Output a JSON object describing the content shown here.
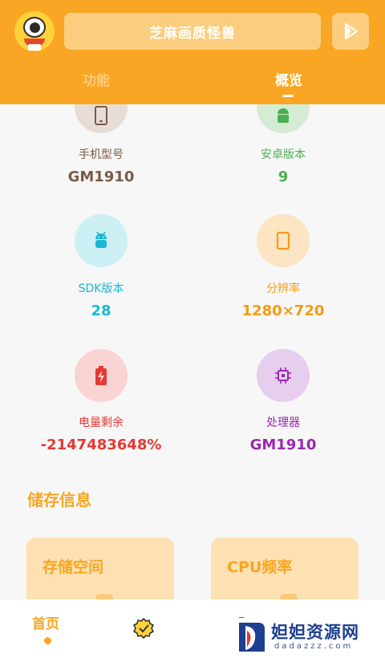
{
  "header": {
    "title": "芝麻画质怪兽",
    "tabs": [
      {
        "label": "功能",
        "active": false
      },
      {
        "label": "概览",
        "active": true
      }
    ],
    "accent_color": "#f8a623",
    "icons": {
      "avatar": "monster-avatar",
      "play": "play-icon"
    }
  },
  "device_info": [
    {
      "label": "手机型号",
      "value": "GM1910",
      "icon": "phone-icon",
      "color": "#7a5a49",
      "circle": "#e6ddd8"
    },
    {
      "label": "安卓版本",
      "value": "9",
      "icon": "android-icon",
      "color": "#4caf50",
      "circle": "#d3ecd3"
    },
    {
      "label": "SDK版本",
      "value": "28",
      "icon": "android-icon",
      "color": "#1ab8d2",
      "circle": "#cdf0f5"
    },
    {
      "label": "分辨率",
      "value": "1280×720",
      "icon": "screen-icon",
      "color": "#f39c12",
      "circle": "#fde4c2"
    },
    {
      "label": "电量剩余",
      "value": "-2147483648%",
      "icon": "battery-icon",
      "color": "#e53935",
      "circle": "#fad3d3"
    },
    {
      "label": "处理器",
      "value": "GM1910",
      "icon": "cpu-icon",
      "color": "#9c27b0",
      "circle": "#e7cdee"
    }
  ],
  "storage": {
    "section_title": "储存信息",
    "cards": [
      {
        "label": "存储空间"
      },
      {
        "label": "CPU频率"
      }
    ]
  },
  "bottom_nav": {
    "home_label": "首页",
    "icons": {
      "badge": "badge-check-icon",
      "other": "circle-icon"
    }
  },
  "watermark": {
    "title": "妲妲资源网",
    "subtitle": "dadazzz.com"
  }
}
